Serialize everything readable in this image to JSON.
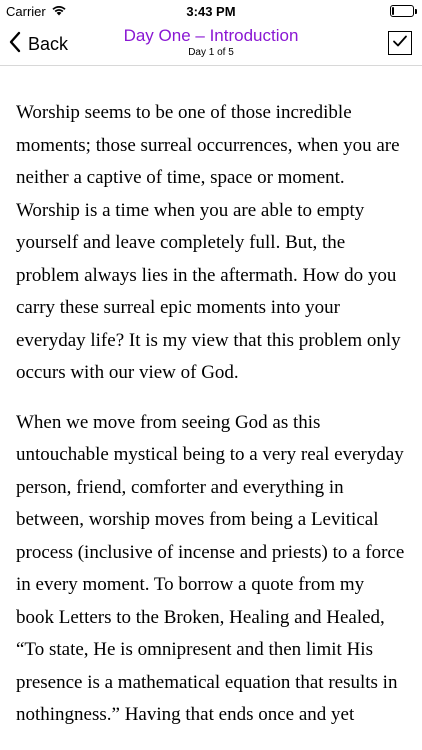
{
  "status_bar": {
    "carrier": "Carrier",
    "time": "3:43 PM",
    "wifi_icon": "wifi-icon",
    "battery_icon": "battery-icon",
    "battery_level": 0.1
  },
  "nav": {
    "back_label": "Back",
    "title": "Day One – Introduction",
    "subtitle": "Day 1 of 5",
    "title_color": "#8a17d3",
    "back_icon": "chevron-left-icon",
    "done_icon": "checkbox-checked-icon"
  },
  "content": {
    "paragraphs": [
      "Worship seems to be one of those incredible moments; those surreal occurrences, when you are neither a captive of time, space or moment. Worship is a time when you are able to empty yourself and leave completely full. But, the problem always lies in the aftermath. How do you carry these surreal epic moments into your everyday life? It is my view that this problem only occurs with our view of God.",
      "When we move from seeing God as this untouchable mystical being to a very real everyday person, friend, comforter and everything in between, worship moves from being a Levitical process (inclusive of incense and priests) to a force in every moment. To borrow a quote from my book Letters to the Broken, Healing and Healed, “To state, He is omnipresent and then limit His presence is a mathematical equation that results in nothingness.” Having that ends once and yet"
    ]
  }
}
